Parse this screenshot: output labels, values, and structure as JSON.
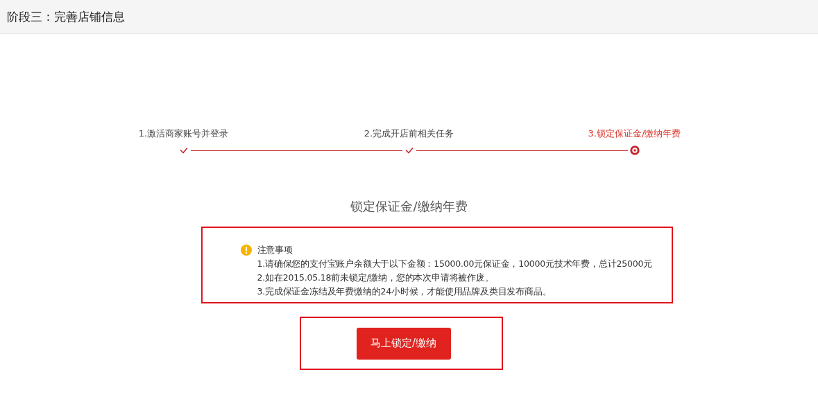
{
  "header": {
    "title": "阶段三：完善店铺信息"
  },
  "steps": [
    {
      "label": "1.激活商家账号并登录",
      "completed": true,
      "selected": false
    },
    {
      "label": "2.完成开店前相关任务",
      "completed": true,
      "selected": false
    },
    {
      "label": "3.锁定保证金/缴纳年费",
      "completed": false,
      "selected": true
    }
  ],
  "section_title": "锁定保证金/缴纳年费",
  "notice": {
    "title": "注意事项",
    "items": [
      "1.请确保您的支付宝账户余额大于以下金额：15000.00元保证金，10000元技术年费，总计25000元",
      "2.如在2015.05.18前未锁定/缴纳，您的本次申请将被作废。",
      "3.完成保证金冻结及年费缴纳的24小时候，才能使用品牌及类目发布商品。"
    ]
  },
  "action_button": {
    "label": "马上锁定/缴纳"
  }
}
